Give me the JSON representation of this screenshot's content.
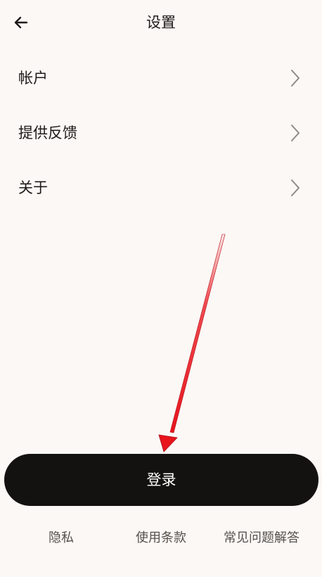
{
  "header": {
    "title": "设置",
    "back_icon": "arrow-left-icon"
  },
  "menu": {
    "items": [
      {
        "label": "帐户",
        "icon": "chevron-right-icon"
      },
      {
        "label": "提供反馈",
        "icon": "chevron-right-icon"
      },
      {
        "label": "关于",
        "icon": "chevron-right-icon"
      }
    ]
  },
  "login_button": {
    "label": "登录"
  },
  "footer": {
    "privacy": "隐私",
    "terms": "使用条款",
    "faq": "常见问题解答"
  },
  "colors": {
    "background": "#fcf8f5",
    "button": "#141211",
    "button_text": "#ffffff",
    "annotation_arrow": "#e8141c"
  }
}
